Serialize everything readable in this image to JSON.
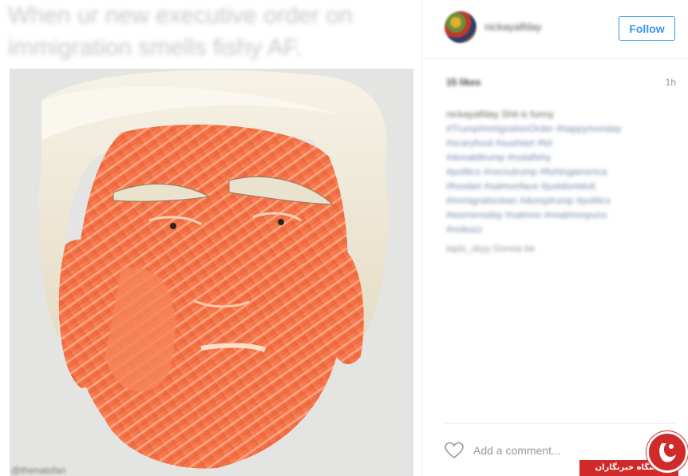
{
  "post": {
    "caption": "When ur new executive order on immigration smells fishy AF.",
    "image_credit": "@thenatsfan"
  },
  "header": {
    "username": "nickayalfday",
    "follow_label": "Follow"
  },
  "meta": {
    "likes": "15 likes",
    "time": "1h"
  },
  "comment": {
    "lines": [
      "nickayalfday Shit is funny",
      "#TrumpImmigrationOrder #happymonday",
      "#scaryfood #sushiart #lol",
      "#donaldtrump #notafishy",
      "#politics #rocnutrump #fishingamerica",
      "#foodart #salmonface #justdontdoit",
      "#immigrationban #dumptrump #politics",
      "#womensday #salmon #noalmonpuns",
      "#nobuzz"
    ],
    "reply": "lapis_skyy Gonna be"
  },
  "footer": {
    "comment_placeholder": "Add a comment..."
  },
  "watermark": {
    "text": "باشگاه خبرنگاران"
  },
  "colors": {
    "follow_blue": "#3897f0",
    "watermark_red": "#d12a2a",
    "salmon": "#f47a4e"
  }
}
